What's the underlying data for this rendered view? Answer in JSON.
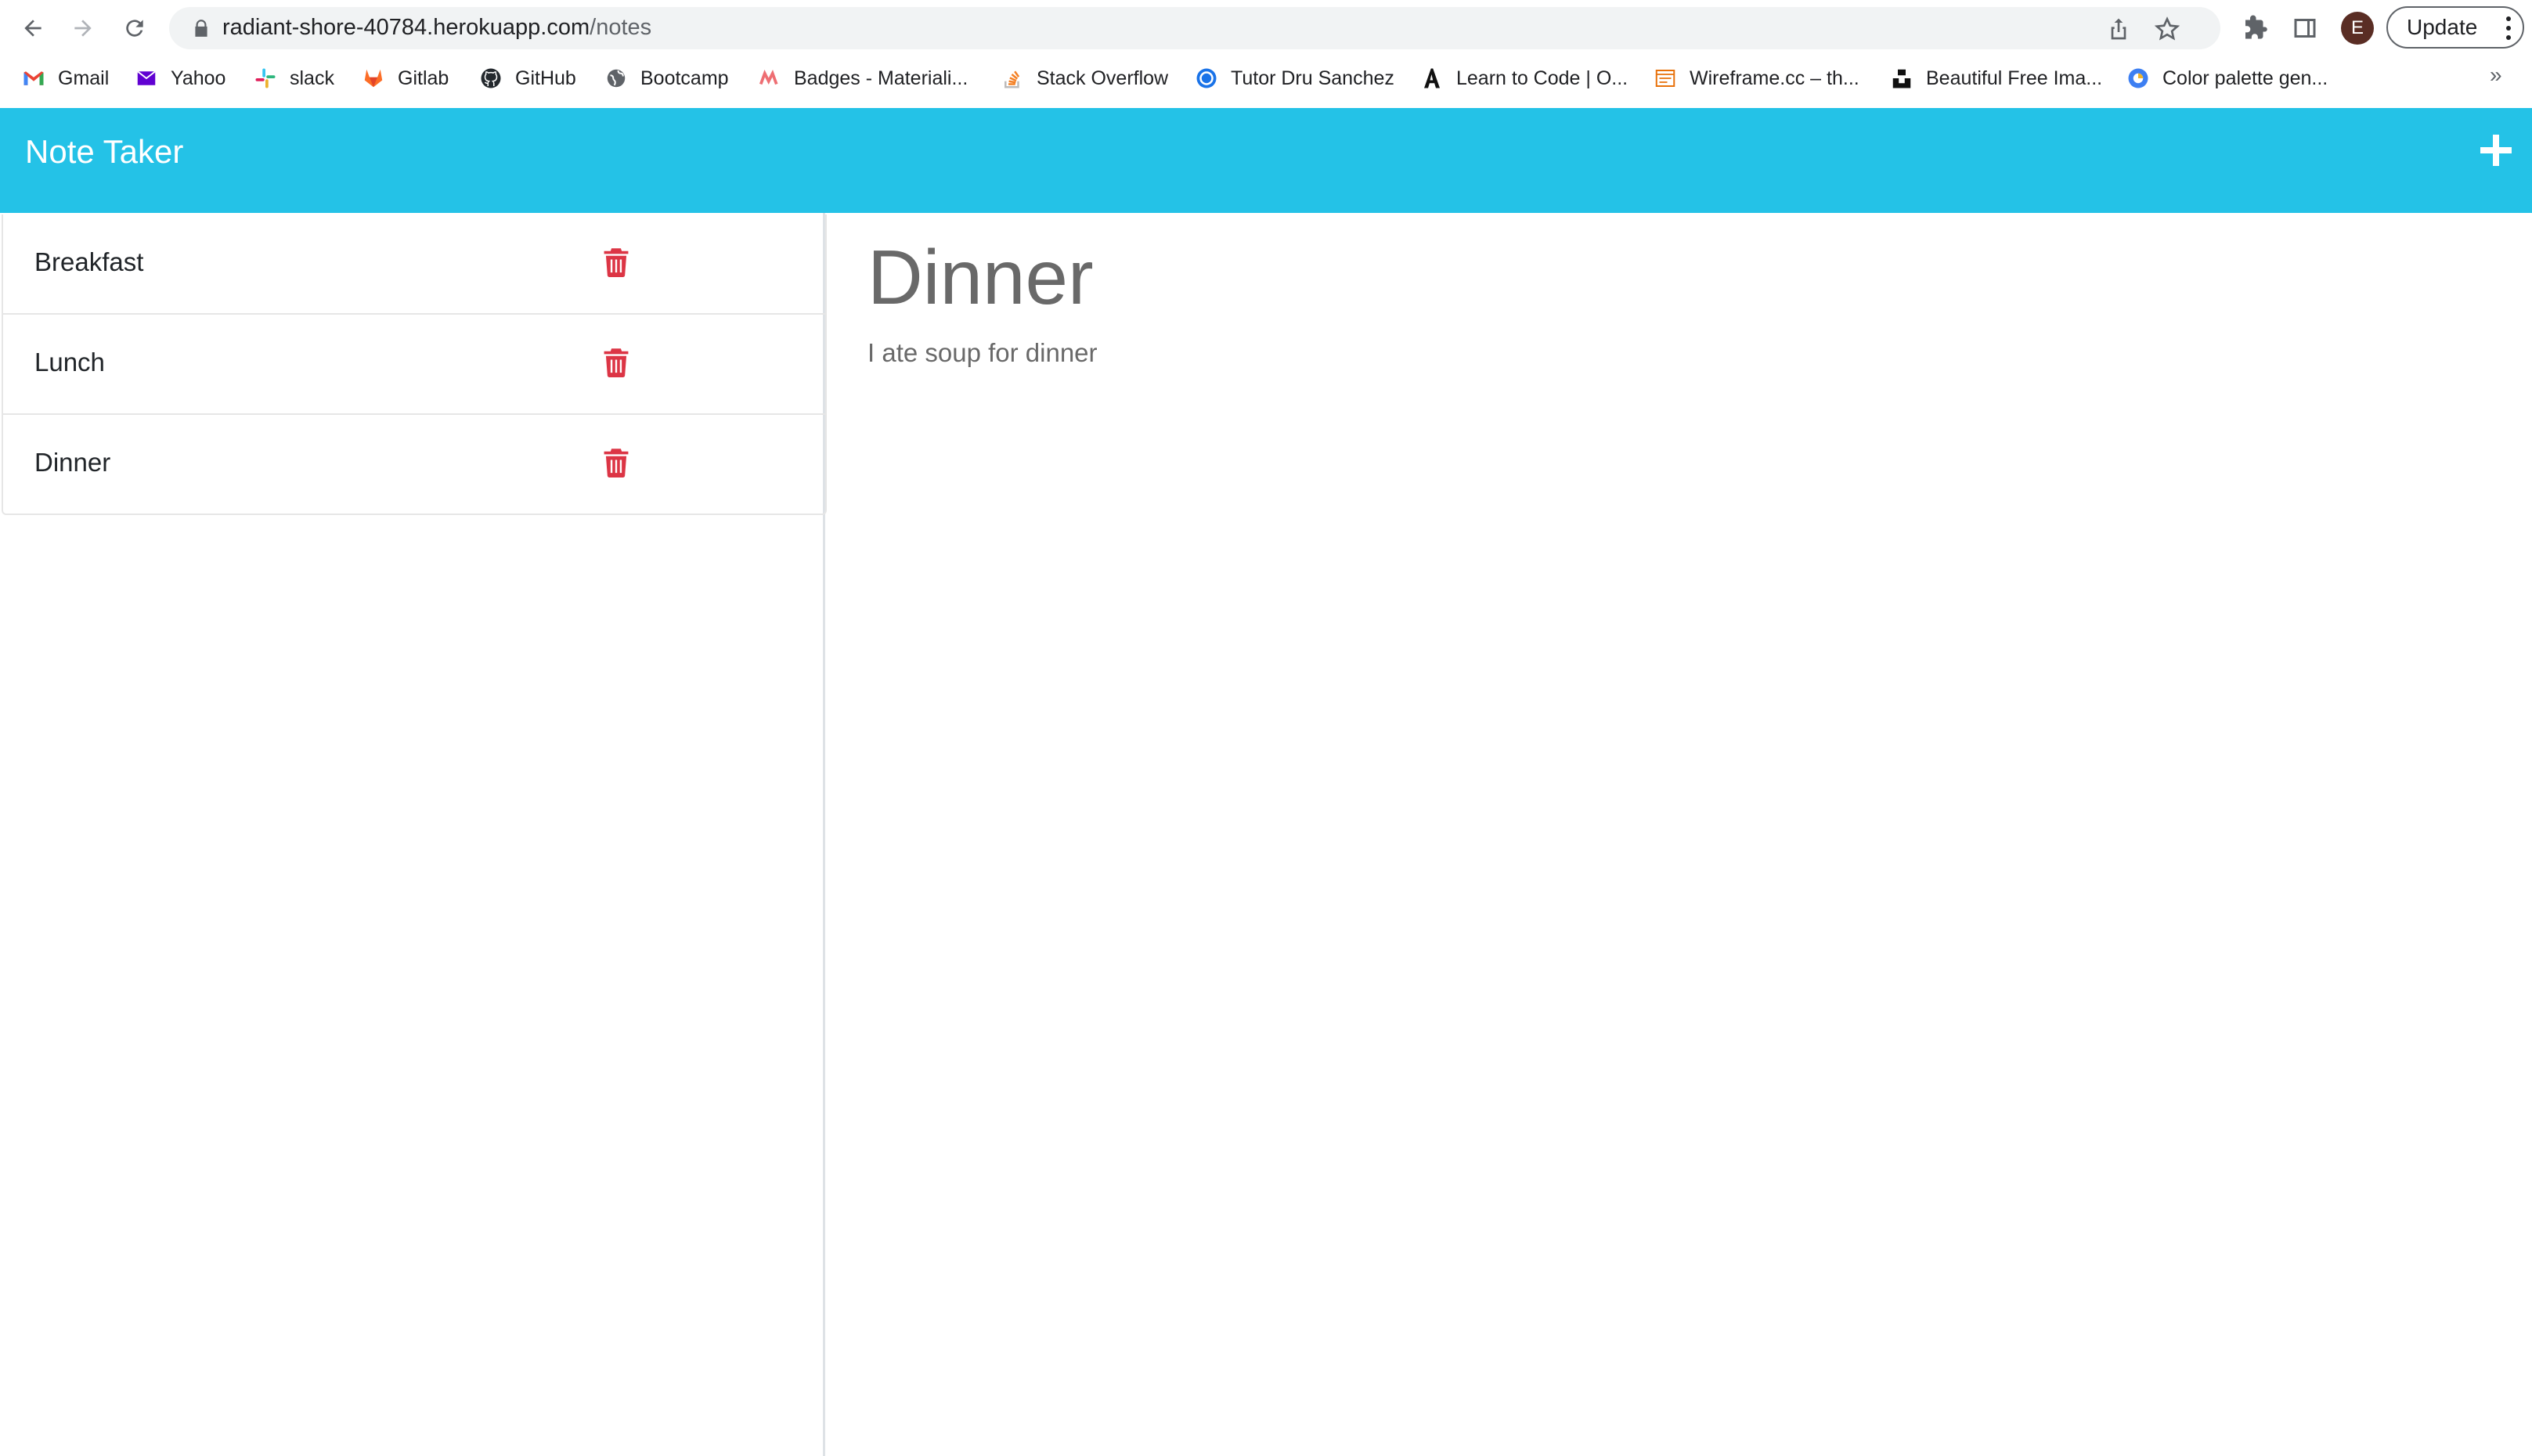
{
  "browser": {
    "url_host": "radiant-shore-40784.herokuapp.com",
    "url_path": "/notes",
    "profile_initial": "E",
    "update_label": "Update",
    "bookmarks": [
      {
        "label": "Gmail",
        "icon": "gmail-icon"
      },
      {
        "label": "Yahoo",
        "icon": "yahoo-icon"
      },
      {
        "label": "slack",
        "icon": "slack-icon"
      },
      {
        "label": "Gitlab",
        "icon": "gitlab-icon"
      },
      {
        "label": "GitHub",
        "icon": "github-icon"
      },
      {
        "label": "Bootcamp",
        "icon": "globe-icon"
      },
      {
        "label": "Badges - Materiali...",
        "icon": "materialize-icon"
      },
      {
        "label": "Stack Overflow",
        "icon": "stackoverflow-icon"
      },
      {
        "label": "Tutor Dru Sanchez",
        "icon": "circle-icon"
      },
      {
        "label": "Learn to Code | O...",
        "icon": "a-logo-icon"
      },
      {
        "label": "Wireframe.cc – th...",
        "icon": "wireframe-icon"
      },
      {
        "label": "Beautiful Free Ima...",
        "icon": "unsplash-icon"
      },
      {
        "label": "Color palette gen...",
        "icon": "coolors-icon"
      }
    ]
  },
  "app": {
    "brand": "Note Taker",
    "notes": [
      {
        "title": "Breakfast"
      },
      {
        "title": "Lunch"
      },
      {
        "title": "Dinner"
      }
    ],
    "active_note": {
      "title": "Dinner",
      "text": "I ate soup for dinner"
    }
  },
  "colors": {
    "navbar": "#24c2e7",
    "trash": "#dc3545",
    "editor_text": "#696969"
  }
}
